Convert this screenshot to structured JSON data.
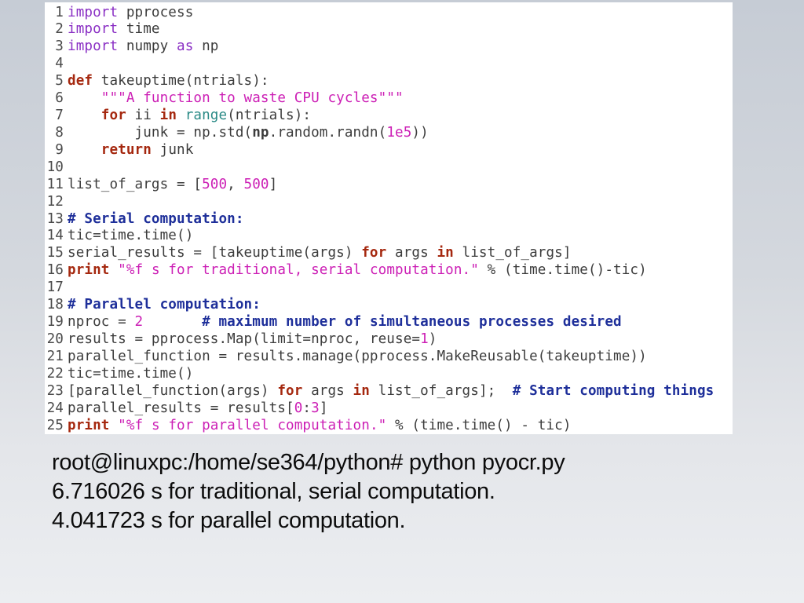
{
  "editor": {
    "language": "python",
    "lines": [
      {
        "n": "1",
        "tokens": [
          [
            "imp",
            "import"
          ],
          [
            "plain",
            " pprocess"
          ]
        ]
      },
      {
        "n": "2",
        "tokens": [
          [
            "imp",
            "import"
          ],
          [
            "plain",
            " time"
          ]
        ]
      },
      {
        "n": "3",
        "tokens": [
          [
            "imp",
            "import"
          ],
          [
            "plain",
            " numpy "
          ],
          [
            "imp",
            "as"
          ],
          [
            "plain",
            " np"
          ]
        ]
      },
      {
        "n": "4",
        "tokens": []
      },
      {
        "n": "5",
        "tokens": [
          [
            "kw",
            "def"
          ],
          [
            "plain",
            " takeuptime(ntrials):"
          ]
        ]
      },
      {
        "n": "6",
        "tokens": [
          [
            "plain",
            "    "
          ],
          [
            "str",
            "\"\"\"A function to waste CPU cycles\"\"\""
          ]
        ]
      },
      {
        "n": "7",
        "tokens": [
          [
            "plain",
            "    "
          ],
          [
            "kw",
            "for"
          ],
          [
            "plain",
            " ii "
          ],
          [
            "kw",
            "in"
          ],
          [
            "plain",
            " "
          ],
          [
            "bi",
            "range"
          ],
          [
            "plain",
            "(ntrials):"
          ]
        ]
      },
      {
        "n": "8",
        "tokens": [
          [
            "plain",
            "        junk = np.std("
          ],
          [
            "bold",
            "np"
          ],
          [
            "plain",
            ".random.randn("
          ],
          [
            "num",
            "1e5"
          ],
          [
            "plain",
            "))"
          ]
        ]
      },
      {
        "n": "9",
        "tokens": [
          [
            "plain",
            "    "
          ],
          [
            "kw",
            "return"
          ],
          [
            "plain",
            " junk"
          ]
        ]
      },
      {
        "n": "10",
        "tokens": []
      },
      {
        "n": "11",
        "tokens": [
          [
            "plain",
            "list_of_args = ["
          ],
          [
            "num",
            "500"
          ],
          [
            "plain",
            ", "
          ],
          [
            "num",
            "500"
          ],
          [
            "plain",
            "]"
          ]
        ]
      },
      {
        "n": "12",
        "tokens": []
      },
      {
        "n": "13",
        "tokens": [
          [
            "com",
            "# Serial computation:"
          ]
        ]
      },
      {
        "n": "14",
        "tokens": [
          [
            "plain",
            "tic=time.time()"
          ]
        ]
      },
      {
        "n": "15",
        "tokens": [
          [
            "plain",
            "serial_results = [takeuptime(args) "
          ],
          [
            "kw",
            "for"
          ],
          [
            "plain",
            " args "
          ],
          [
            "kw",
            "in"
          ],
          [
            "plain",
            " list_of_args]"
          ]
        ]
      },
      {
        "n": "16",
        "tokens": [
          [
            "kw",
            "print"
          ],
          [
            "plain",
            " "
          ],
          [
            "str",
            "\"%f s for traditional, serial computation.\""
          ],
          [
            "plain",
            " % (time.time()-tic)"
          ]
        ]
      },
      {
        "n": "17",
        "tokens": []
      },
      {
        "n": "18",
        "tokens": [
          [
            "com",
            "# Parallel computation:"
          ]
        ]
      },
      {
        "n": "19",
        "tokens": [
          [
            "plain",
            "nproc = "
          ],
          [
            "num",
            "2"
          ],
          [
            "plain",
            "       "
          ],
          [
            "com",
            "# maximum number of simultaneous processes desired"
          ]
        ]
      },
      {
        "n": "20",
        "tokens": [
          [
            "plain",
            "results = pprocess.Map(limit=nproc, reuse="
          ],
          [
            "num",
            "1"
          ],
          [
            "plain",
            ")"
          ]
        ]
      },
      {
        "n": "21",
        "tokens": [
          [
            "plain",
            "parallel_function = results.manage(pprocess.MakeReusable(takeuptime))"
          ]
        ]
      },
      {
        "n": "22",
        "tokens": [
          [
            "plain",
            "tic=time.time()"
          ]
        ]
      },
      {
        "n": "23",
        "tokens": [
          [
            "plain",
            "[parallel_function(args) "
          ],
          [
            "kw",
            "for"
          ],
          [
            "plain",
            " args "
          ],
          [
            "kw",
            "in"
          ],
          [
            "plain",
            " list_of_args];  "
          ],
          [
            "com",
            "# Start computing things"
          ]
        ]
      },
      {
        "n": "24",
        "tokens": [
          [
            "plain",
            "parallel_results = results["
          ],
          [
            "num",
            "0"
          ],
          [
            "plain",
            ":"
          ],
          [
            "num",
            "3"
          ],
          [
            "plain",
            "]"
          ]
        ]
      },
      {
        "n": "25",
        "tokens": [
          [
            "kw",
            "print"
          ],
          [
            "plain",
            " "
          ],
          [
            "str",
            "\"%f s for parallel computation.\""
          ],
          [
            "plain",
            " % (time.time() - tic)"
          ]
        ]
      }
    ]
  },
  "terminal": {
    "prompt_line": "root@linuxpc:/home/se364/python# python pyocr.py",
    "output_lines": [
      "6.716026 s for traditional, serial computation.",
      "4.041723 s for parallel computation."
    ]
  },
  "colors": {
    "keyword": "#a5280f",
    "import_keyword": "#8a2fc4",
    "string": "#cc1fb5",
    "number": "#cc1fb5",
    "comment": "#1e2f9a",
    "builtin": "#2a8a86",
    "text": "#3c3c3c"
  }
}
